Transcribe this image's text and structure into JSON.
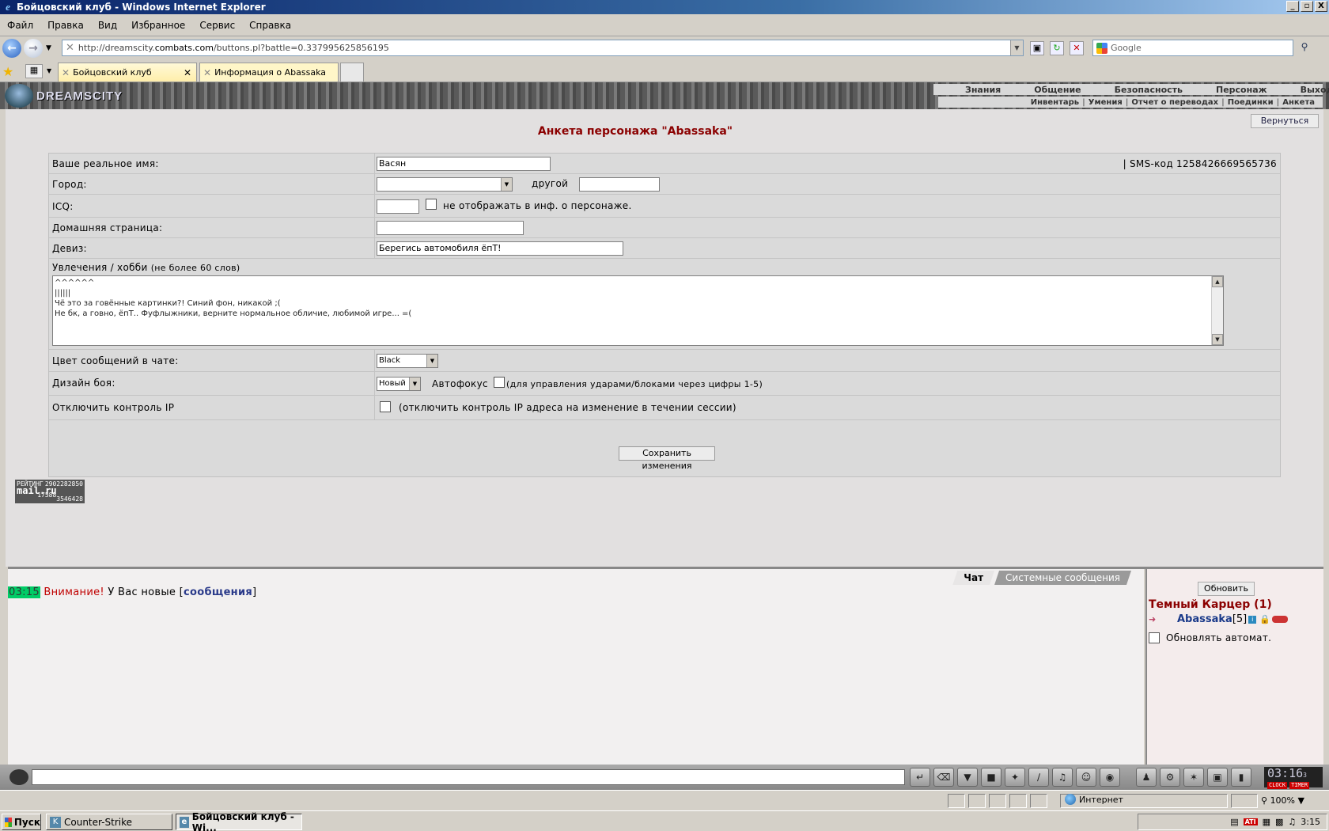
{
  "window": {
    "title": "Бойцовский клуб - Windows Internet Explorer",
    "buttons": [
      "_",
      "▫",
      "X"
    ]
  },
  "menu": [
    "Файл",
    "Правка",
    "Вид",
    "Избранное",
    "Сервис",
    "Справка"
  ],
  "address": {
    "url_prefix": "http://dreamscity.",
    "url_domain": "combats.com",
    "url_suffix": "/buttons.pl?battle=0.337995625856195",
    "search_placeholder": "Google"
  },
  "tabs": [
    {
      "label": "Бойцовский клуб",
      "active": true
    },
    {
      "label": "Информация о Abassaka",
      "active": false
    }
  ],
  "game_header": {
    "logo": "DREAMSCITY",
    "nav_top": [
      "Знания",
      "Общение",
      "Безопасность",
      "Персонаж",
      "Выход"
    ],
    "nav_sub": [
      "Инвентарь",
      "Умения",
      "Отчет о переводах",
      "Поединки",
      "Анкета"
    ]
  },
  "page": {
    "back_button": "Вернуться",
    "title": "Анкета персонажа \"Abassaka\"",
    "fields": {
      "real_name_label": "Ваше реальное имя:",
      "real_name_value": "Васян",
      "sms_code": "| SMS-код 1258426669565736",
      "city_label": "Город:",
      "city_other_label": "другой",
      "icq_label": "ICQ:",
      "icq_hide_label": "не отображать в инф. о персонаже.",
      "homepage_label": "Домашняя страница:",
      "motto_label": "Девиз:",
      "motto_value": "Берегись автомобиля ёпТ!",
      "hobby_label": "Увлечения / хобби",
      "hobby_note": "(не более 60 слов)",
      "hobby_lines": [
        "^^^^^^",
        "||||||",
        "Чё это за говённые картинки?! Синий фон, никакой ;(",
        "Не бк, а говно, ёпТ.. Фуфлыжники, верните нормальное обличие, любимой игре... =("
      ],
      "chat_color_label": "Цвет сообщений в чате:",
      "chat_color_value": "Black",
      "battle_design_label": "Дизайн боя:",
      "battle_design_value": "Новый",
      "autofocus_label": "Автофокус",
      "autofocus_note": "(для управления ударами/блоками через цифры 1-5)",
      "ip_control_label": "Отключить контроль IP",
      "ip_control_note": "(отключить контроль IP адреса на изменение в течении сессии)"
    },
    "save_button": "Сохранить изменения",
    "rating": {
      "label": "РЕЙТИНГ",
      "brand": "mail.ru",
      "n1": "2902282850",
      "n2": "3546428",
      "n3": "17588"
    }
  },
  "chat": {
    "tabs": [
      "Чат",
      "Системные сообщения"
    ],
    "message": {
      "time": "03:15",
      "warning": "Внимание!",
      "text": " У Вас новые [",
      "link": "сообщения",
      "end": "]"
    }
  },
  "sidebar": {
    "refresh_button": "Обновить",
    "room": "Темный Карцер (1)",
    "user_nick": "Abassaka",
    "user_level": "[5]",
    "auto_refresh_label": "Обновлять автомат."
  },
  "game_toolbar": {
    "clock": "03:16",
    "clock_sec": "3",
    "clock_labels": [
      "CLOCK",
      "TIMER"
    ]
  },
  "statusbar": {
    "zone": "Интернет",
    "zoom": "100%"
  },
  "taskbar": {
    "start": "Пуск",
    "tasks": [
      "Counter-Strike",
      "Бойцовский клуб - Wi..."
    ],
    "time": "3:15"
  }
}
